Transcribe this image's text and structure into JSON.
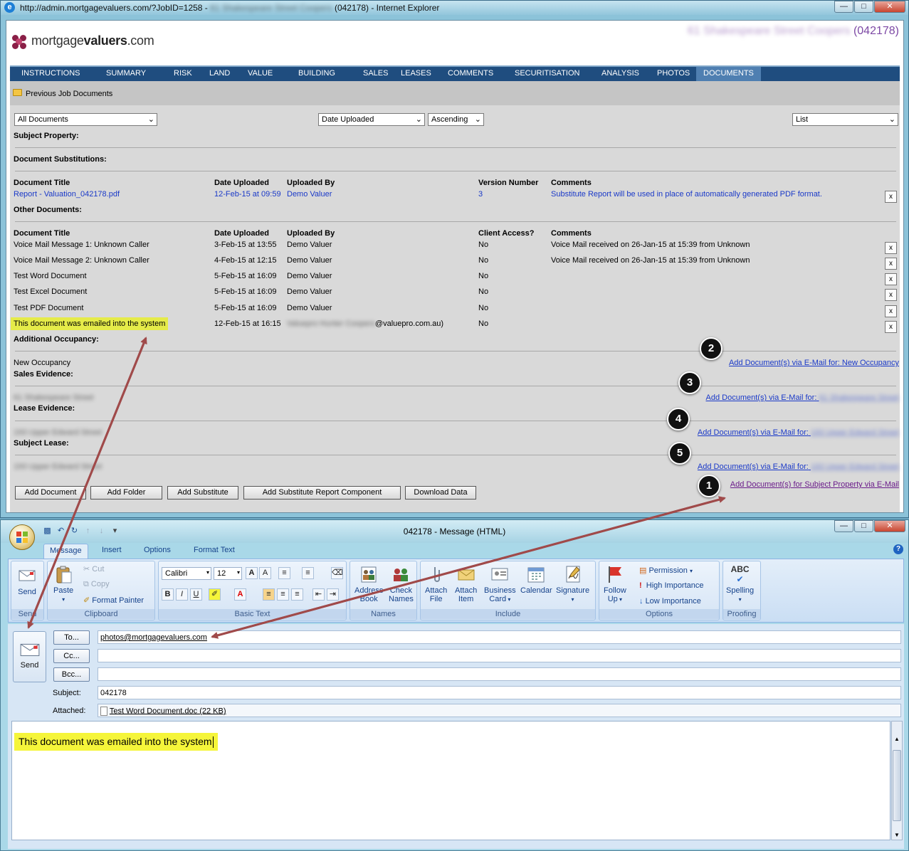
{
  "ie": {
    "title_prefix": "http://admin.mortgagevaluers.com/?JobID=1258 -",
    "title_blurred": "61 Shakespeare Street Coopers",
    "title_suffix": "(042178) - Internet Explorer",
    "brand_light": "mortgage",
    "brand_bold": "valuers",
    "brand_tail": ".com",
    "job_blurred": "61 Shakespeare Street Coopers",
    "job_number": "(042178)"
  },
  "tabs": [
    "INSTRUCTIONS",
    "SUMMARY",
    "RISK",
    "LAND",
    "VALUE",
    "BUILDING",
    "SALES",
    "LEASES",
    "COMMENTS",
    "SECURITISATION",
    "ANALYSIS",
    "PHOTOS",
    "DOCUMENTS"
  ],
  "active_tab": "DOCUMENTS",
  "previous_docs_label": "Previous Job Documents",
  "filters": {
    "category": "All Documents",
    "sort_by": "Date Uploaded",
    "order": "Ascending",
    "view": "List"
  },
  "sections": {
    "subject_property": "Subject Property:",
    "document_substitutions": "Document Substitutions:",
    "other_documents": "Other Documents:",
    "additional_occupancy": "Additional Occupancy:",
    "sales_evidence": "Sales Evidence:",
    "lease_evidence": "Lease Evidence:",
    "subject_lease": "Subject Lease:"
  },
  "substitution_table": {
    "headers": [
      "Document Title",
      "Date Uploaded",
      "Uploaded By",
      "Version Number",
      "Comments"
    ],
    "row": [
      "Report - Valuation_042178.pdf",
      "12-Feb-15 at 09:59",
      "Demo Valuer",
      "3",
      "Substitute Report will be used in place of automatically generated PDF format."
    ]
  },
  "documents_table": {
    "headers": [
      "Document Title",
      "Date Uploaded",
      "Uploaded By",
      "Client Access?",
      "Comments"
    ],
    "rows": [
      [
        "Voice Mail Message 1: Unknown Caller",
        "3-Feb-15 at 13:55",
        "Demo Valuer",
        "No",
        "Voice Mail received on 26-Jan-15 at 15:39 from Unknown"
      ],
      [
        "Voice Mail Message 2: Unknown Caller",
        "4-Feb-15 at 12:15",
        "Demo Valuer",
        "No",
        "Voice Mail received on 26-Jan-15 at 15:39 from Unknown"
      ],
      [
        "Test Word Document",
        "5-Feb-15 at 16:09",
        "Demo Valuer",
        "No",
        ""
      ],
      [
        "Test Excel Document",
        "5-Feb-15 at 16:09",
        "Demo Valuer",
        "No",
        ""
      ],
      [
        "Test PDF Document",
        "5-Feb-15 at 16:09",
        "Demo Valuer",
        "No",
        ""
      ],
      [
        "This document was emailed into the system",
        "12-Feb-15 at 16:15",
        "@valuepro.com.au)",
        "No",
        ""
      ]
    ],
    "emailed_sender_blurred": "Valuepro Hunter Coopers",
    "delete_label": "x"
  },
  "occupancy": {
    "item": "New Occupancy",
    "link": "Add Document(s) via E-Mail for: New Occupancy"
  },
  "sales_item_blurred": "61 Shakespeare Street",
  "lease_item_blurred": "193 Upper Edward Street",
  "subject_lease_item_blurred": "193 Upper Edward Street",
  "email_link_prefix": "Add Document(s) via E-Mail for:",
  "subject_property_link": "Add Document(s) for Subject Property via E-Mail",
  "buttons": [
    "Add Document",
    "Add Folder",
    "Add Substitute",
    "Add Substitute Report Component",
    "Download Data"
  ],
  "callouts": [
    "1",
    "2",
    "3",
    "4",
    "5"
  ],
  "outlook": {
    "title": "042178 - Message (HTML)",
    "ribbon_tabs": [
      "Message",
      "Insert",
      "Options",
      "Format Text"
    ],
    "clipboard": {
      "paste": "Paste",
      "cut": "Cut",
      "copy": "Copy",
      "format_painter": "Format Painter"
    },
    "send": "Send",
    "font": "Calibri",
    "font_size": "12",
    "names": {
      "address_book_1": "Address",
      "address_book_2": "Book",
      "check_names_1": "Check",
      "check_names_2": "Names"
    },
    "include": {
      "attach_file_1": "Attach",
      "attach_file_2": "File",
      "attach_item_1": "Attach",
      "attach_item_2": "Item",
      "business_card_1": "Business",
      "business_card_2": "Card",
      "calendar": "Calendar",
      "signature": "Signature"
    },
    "options": {
      "follow_up_1": "Follow",
      "follow_up_2": "Up",
      "permission": "Permission",
      "high": "High Importance",
      "low": "Low Importance"
    },
    "proofing": {
      "spelling": "Spelling",
      "abc": "ABC"
    },
    "groups": [
      "Send",
      "Clipboard",
      "Basic Text",
      "Names",
      "Include",
      "Options",
      "Proofing"
    ],
    "to_label": "To...",
    "cc_label": "Cc...",
    "bcc_label": "Bcc...",
    "to_value": "photos@mortgagevaluers.com",
    "subject_label": "Subject:",
    "subject_value": "042178",
    "attached_label": "Attached:",
    "attachment": "Test Word Document.doc (22 KB)",
    "body": "This document was emailed into the system"
  },
  "colors": {
    "tab_bar": "#1f4d7f",
    "highlight": "#e5eb49",
    "arrow": "#a04a4a",
    "brand_mark": "#8a1f47"
  }
}
